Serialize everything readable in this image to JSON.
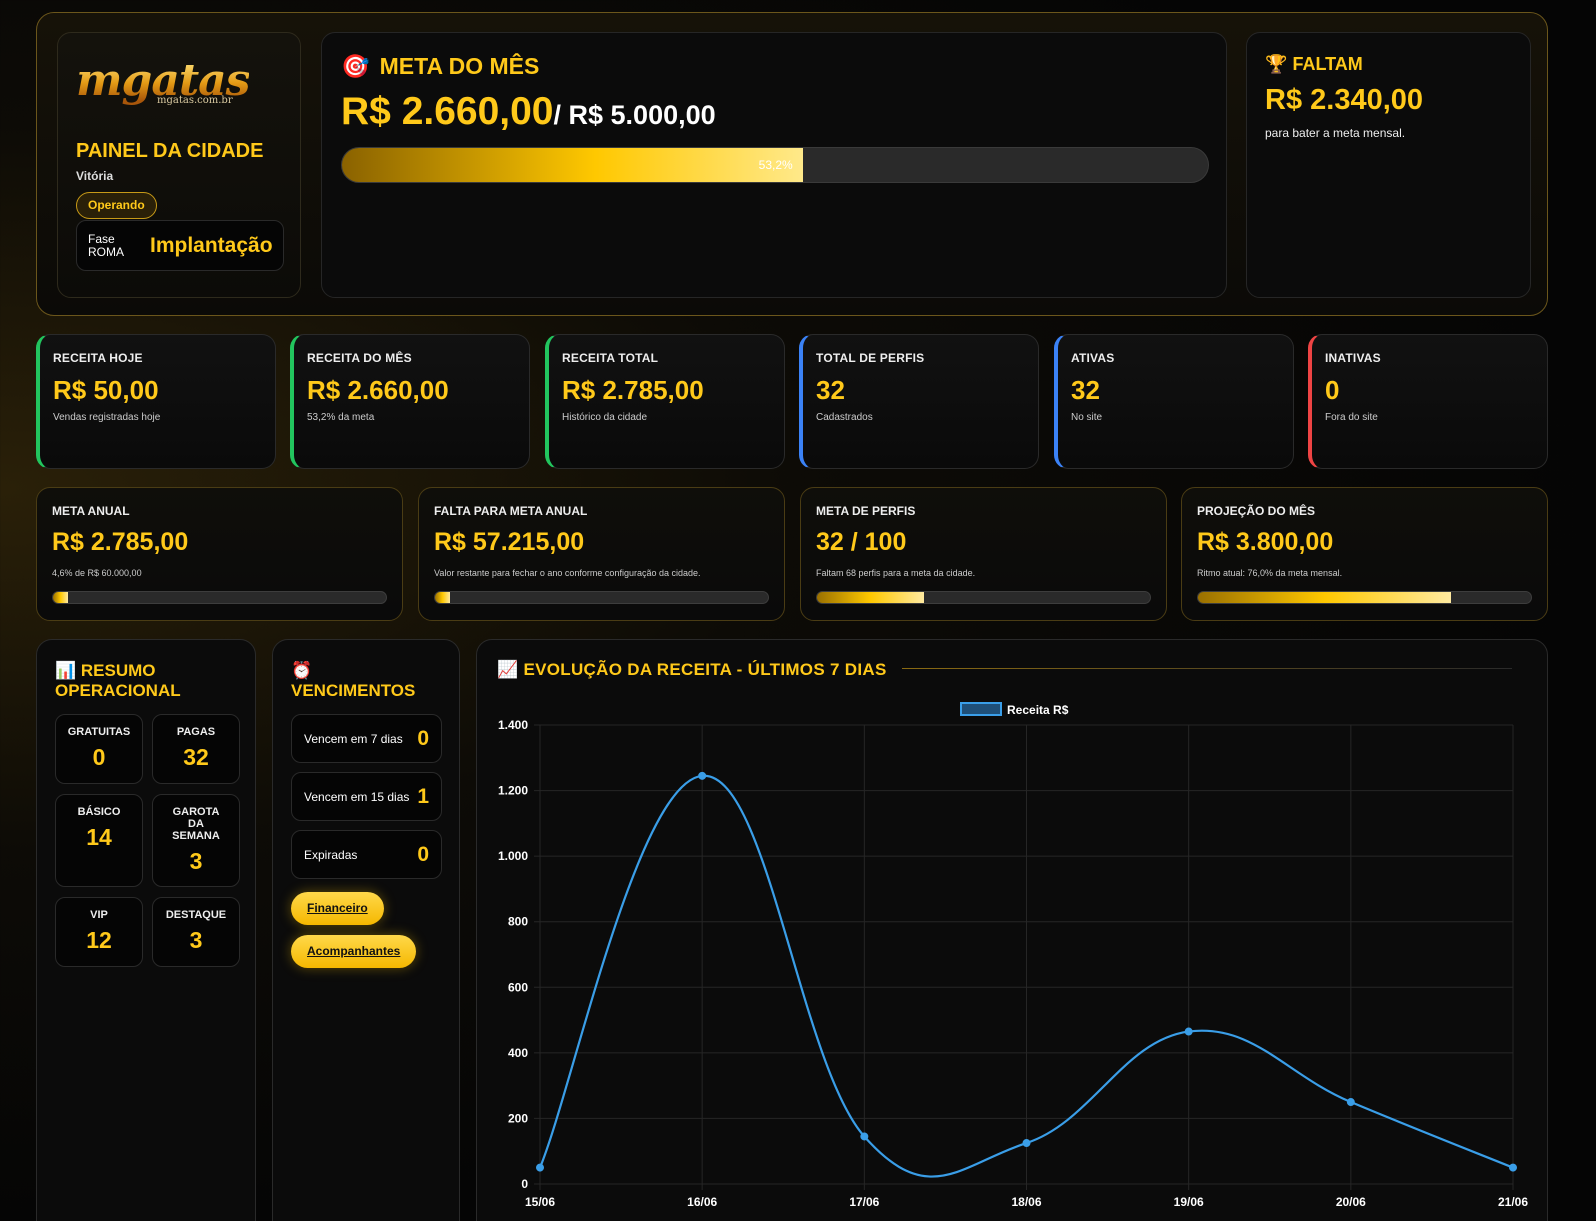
{
  "brand": {
    "logo_text": "mgatas",
    "logo_sub": "mgatas.com.br"
  },
  "panel": {
    "title": "PAINEL DA CIDADE",
    "city": "Vitória",
    "status": "Operando",
    "phase_label_1": "Fase",
    "phase_label_2": "ROMA",
    "phase_value": "Implantação"
  },
  "goal": {
    "icon": "🎯",
    "title": "META DO MÊS",
    "amount": "R$ 2.660,00",
    "of": "/ R$ 5.000,00",
    "percent_label": "53,2%",
    "progress": 0.532
  },
  "remaining": {
    "icon": "🏆",
    "title": "FALTAM",
    "amount": "R$ 2.340,00",
    "sub": "para bater a meta mensal."
  },
  "stats": [
    {
      "label": "RECEITA HOJE",
      "value": "R$ 50,00",
      "sub": "Vendas registradas hoje",
      "accent": "#22c55e"
    },
    {
      "label": "RECEITA DO MÊS",
      "value": "R$ 2.660,00",
      "sub": "53,2% da meta",
      "accent": "#22c55e"
    },
    {
      "label": "RECEITA TOTAL",
      "value": "R$ 2.785,00",
      "sub": "Histórico da cidade",
      "accent": "#22c55e"
    },
    {
      "label": "TOTAL DE PERFIS",
      "value": "32",
      "sub": "Cadastrados",
      "accent": "#3b82f6"
    },
    {
      "label": "ATIVAS",
      "value": "32",
      "sub": "No site",
      "accent": "#3b82f6"
    },
    {
      "label": "INATIVAS",
      "value": "0",
      "sub": "Fora do site",
      "accent": "#ef4444"
    }
  ],
  "metas": [
    {
      "label": "META ANUAL",
      "value": "R$ 2.785,00",
      "sub": "4,6% de R$ 60.000,00",
      "progress": 0.046
    },
    {
      "label": "FALTA PARA META ANUAL",
      "value": "R$ 57.215,00",
      "sub": "Valor restante para fechar o ano conforme configuração da cidade.",
      "progress": 0.046
    },
    {
      "label": "META DE PERFIS",
      "value": "32 / 100",
      "sub": "Faltam 68 perfis para a meta da cidade.",
      "progress": 0.32
    },
    {
      "label": "PROJEÇÃO DO MÊS",
      "value": "R$ 3.800,00",
      "sub": "Ritmo atual: 76,0% da meta mensal.",
      "progress": 0.76
    }
  ],
  "resumo": {
    "icon": "📊",
    "title_1": "RESUMO",
    "title_2": "OPERACIONAL",
    "items": [
      {
        "label": "GRATUITAS",
        "value": "0"
      },
      {
        "label": "PAGAS",
        "value": "32"
      },
      {
        "label": "BÁSICO",
        "value": "14"
      },
      {
        "label": "GAROTA DA SEMANA",
        "value": "3"
      },
      {
        "label": "VIP",
        "value": "12"
      },
      {
        "label": "DESTAQUE",
        "value": "3"
      }
    ]
  },
  "vencimentos": {
    "icon": "⏰",
    "title": "VENCIMENTOS",
    "rows": [
      {
        "label": "Vencem em 7 dias",
        "value": "0"
      },
      {
        "label": "Vencem em 15 dias",
        "value": "1"
      },
      {
        "label": "Expiradas",
        "value": "0"
      }
    ],
    "buttons": [
      "Financeiro",
      "Acompanhantes"
    ]
  },
  "chart_section": {
    "icon": "📈",
    "title": "EVOLUÇÃO DA RECEITA - ÚLTIMOS 7 DIAS"
  },
  "chart_data": {
    "type": "line",
    "categories": [
      "15/06",
      "16/06",
      "17/06",
      "18/06",
      "19/06",
      "20/06",
      "21/06"
    ],
    "series": [
      {
        "name": "Receita R$",
        "values": [
          50,
          1245,
          145,
          125,
          465,
          250,
          50
        ],
        "color": "#3a9ee8"
      }
    ],
    "ylim": [
      0,
      1400
    ],
    "yticks": [
      "0",
      "200",
      "400",
      "600",
      "800",
      "1.000",
      "1.200",
      "1.400"
    ],
    "grid": true,
    "legend": "top-center"
  }
}
